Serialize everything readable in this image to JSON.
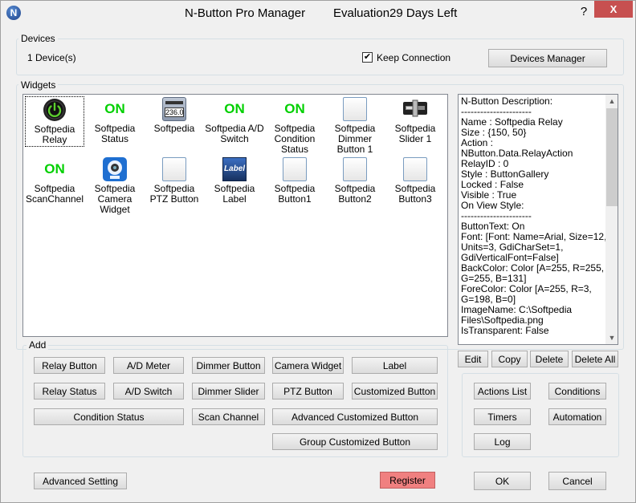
{
  "titlebar": {
    "app_title": "N-Button Pro Manager",
    "evaluation": "Evaluation29 Days Left",
    "help": "?",
    "close": "X",
    "icon_letter": "N"
  },
  "devices": {
    "group_label": "Devices",
    "count_text": "1 Device(s)",
    "keep_connection_label": "Keep Connection",
    "keep_connection_checked": "✔",
    "manager_button": "Devices Manager"
  },
  "widgets": {
    "group_label": "Widgets",
    "items": [
      {
        "label": "Softpedia Relay",
        "icon": "power-icon"
      },
      {
        "label": "Softpedia Status",
        "on": "ON"
      },
      {
        "label": "Softpedia",
        "icon": "meter-icon",
        "display": "236.0"
      },
      {
        "label": "Softpedia A/D Switch",
        "on": "ON"
      },
      {
        "label": "Softpedia Condition Status",
        "on": "ON"
      },
      {
        "label": "Softpedia Dimmer Button 1",
        "icon": "blank-button-icon"
      },
      {
        "label": "Softpedia Slider 1",
        "icon": "slider-icon"
      },
      {
        "label": "Softpedia ScanChannel",
        "on": "ON"
      },
      {
        "label": "Softpedia Camera Widget",
        "icon": "camera-icon"
      },
      {
        "label": "Softpedia PTZ Button",
        "icon": "blank-button-icon"
      },
      {
        "label": "Softpedia Label",
        "icon": "label-icon",
        "display": "Label"
      },
      {
        "label": "Softpedia Button1",
        "icon": "blank-button-icon"
      },
      {
        "label": "Softpedia Button2",
        "icon": "blank-button-icon"
      },
      {
        "label": "Softpedia Button3",
        "icon": "blank-button-icon"
      }
    ]
  },
  "description": {
    "text": "N-Button Description:\n----------------------\nName : Softpedia Relay\nSize : {150, 50}\nAction : NButton.Data.RelayAction\nRelayID : 0\nStyle : ButtonGallery\nLocked : False\nVisible : True\nOn View Style:\n----------------------\nButtonText: On\nFont: [Font: Name=Arial, Size=12, Units=3, GdiCharSet=1, GdiVerticalFont=False]\nBackColor: Color [A=255, R=255, G=255, B=131]\nForeColor: Color [A=255, R=3, G=198, B=0]\nImageName: C:\\Softpedia Files\\Softpedia.png\nIsTransparent: False",
    "edit": "Edit",
    "copy": "Copy",
    "delete": "Delete",
    "delete_all": "Delete All"
  },
  "add": {
    "group_label": "Add",
    "relay_button": "Relay Button",
    "ad_meter": "A/D Meter",
    "dimmer_button": "Dimmer Button",
    "camera_widget": "Camera Widget",
    "label": "Label",
    "relay_status": "Relay Status",
    "ad_switch": "A/D Switch",
    "dimmer_slider": "Dimmer Slider",
    "ptz_button": "PTZ Button",
    "customized_button": "Customized Button",
    "condition_status": "Condition Status",
    "scan_channel": "Scan Channel",
    "advanced_customized_button": "Advanced Customized Button",
    "group_customized_button": "Group Customized Button"
  },
  "actions": {
    "actions_list": "Actions List",
    "conditions": "Conditions",
    "timers": "Timers",
    "automation": "Automation",
    "log": "Log"
  },
  "footer": {
    "advanced_setting": "Advanced Setting",
    "register": "Register",
    "ok": "OK",
    "cancel": "Cancel"
  },
  "colors": {
    "on_green": "#00d000",
    "register_red": "#f08080",
    "close_red": "#c75050"
  }
}
